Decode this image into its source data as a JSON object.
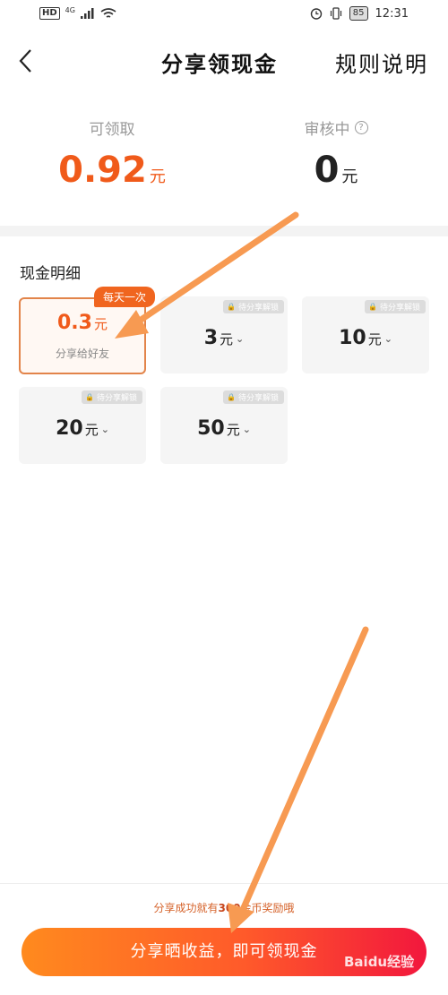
{
  "status_bar": {
    "left_badge": "HD",
    "network": "4G",
    "battery": "85",
    "time": "12:31"
  },
  "header": {
    "title": "分享领现金",
    "rules_label": "规则说明"
  },
  "balance": {
    "available_label": "可领取",
    "available_amount": "0.92",
    "available_unit": "元",
    "reviewing_label": "审核中",
    "reviewing_amount": "0",
    "reviewing_unit": "元"
  },
  "cash_detail": {
    "title": "现金明细",
    "lock_text": "待分享解锁",
    "cards": [
      {
        "amount": "0.3",
        "unit": "元",
        "badge": "每天一次",
        "subtitle": "分享给好友"
      },
      {
        "amount": "3",
        "unit": "元"
      },
      {
        "amount": "10",
        "unit": "元"
      },
      {
        "amount": "20",
        "unit": "元"
      },
      {
        "amount": "50",
        "unit": "元"
      }
    ]
  },
  "footer": {
    "tip_prefix": "分享成功就有",
    "tip_number": "300",
    "tip_suffix": "金币奖励哦",
    "cta_label": "分享晒收益，即可领现金"
  },
  "watermark": "Baidu经验",
  "colors": {
    "accent": "#f05a1a",
    "annotation_arrow": "#f79a52"
  }
}
